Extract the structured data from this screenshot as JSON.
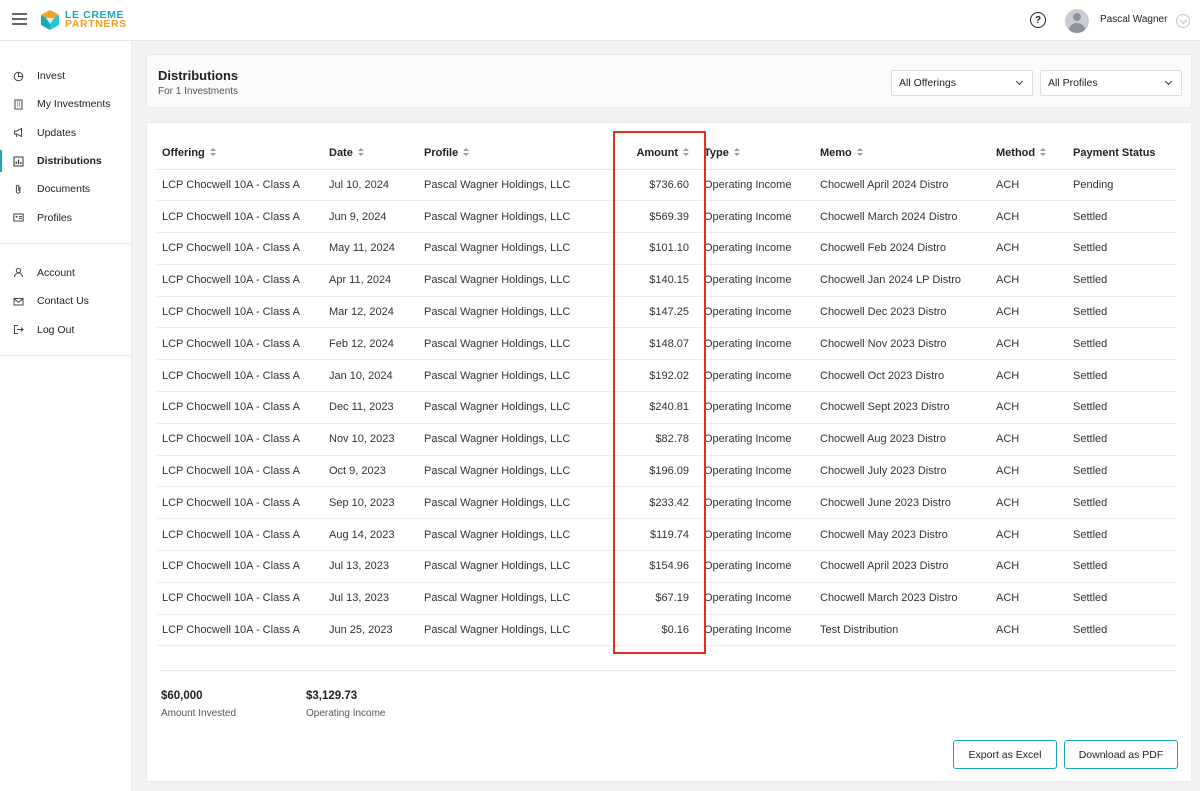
{
  "brand": {
    "line1": "LE CREME",
    "line2": "PARTNERS",
    "teal": "#1aa7b8",
    "orange": "#f0a325"
  },
  "topbar": {
    "help_glyph": "?",
    "username": "Pascal Wagner"
  },
  "sidebar": {
    "primary": [
      {
        "label": "Invest",
        "icon": "pie-chart-icon"
      },
      {
        "label": "My Investments",
        "icon": "building-icon"
      },
      {
        "label": "Updates",
        "icon": "megaphone-icon"
      },
      {
        "label": "Distributions",
        "icon": "report-icon",
        "active": true
      },
      {
        "label": "Documents",
        "icon": "paperclip-icon"
      },
      {
        "label": "Profiles",
        "icon": "id-card-icon"
      }
    ],
    "secondary": [
      {
        "label": "Account",
        "icon": "user-icon"
      },
      {
        "label": "Contact Us",
        "icon": "mail-icon"
      },
      {
        "label": "Log Out",
        "icon": "logout-icon"
      }
    ]
  },
  "header": {
    "title": "Distributions",
    "subtitle": "For 1 Investments",
    "filters": {
      "offerings": "All Offerings",
      "profiles": "All Profiles"
    }
  },
  "table": {
    "columns": [
      "Offering",
      "Date",
      "Profile",
      "Amount",
      "Type",
      "Memo",
      "Method",
      "Payment Status"
    ],
    "rows": [
      [
        "LCP Chocwell 10A - Class A",
        "Jul 10, 2024",
        "Pascal Wagner Holdings, LLC",
        "$736.60",
        "Operating Income",
        "Chocwell April 2024 Distro",
        "ACH",
        "Pending"
      ],
      [
        "LCP Chocwell 10A - Class A",
        "Jun 9, 2024",
        "Pascal Wagner Holdings, LLC",
        "$569.39",
        "Operating Income",
        "Chocwell March 2024 Distro",
        "ACH",
        "Settled"
      ],
      [
        "LCP Chocwell 10A - Class A",
        "May 11, 2024",
        "Pascal Wagner Holdings, LLC",
        "$101.10",
        "Operating Income",
        "Chocwell Feb 2024 Distro",
        "ACH",
        "Settled"
      ],
      [
        "LCP Chocwell 10A - Class A",
        "Apr 11, 2024",
        "Pascal Wagner Holdings, LLC",
        "$140.15",
        "Operating Income",
        "Chocwell Jan 2024 LP Distro",
        "ACH",
        "Settled"
      ],
      [
        "LCP Chocwell 10A - Class A",
        "Mar 12, 2024",
        "Pascal Wagner Holdings, LLC",
        "$147.25",
        "Operating Income",
        "Chocwell Dec 2023 Distro",
        "ACH",
        "Settled"
      ],
      [
        "LCP Chocwell 10A - Class A",
        "Feb 12, 2024",
        "Pascal Wagner Holdings, LLC",
        "$148.07",
        "Operating Income",
        "Chocwell Nov 2023 Distro",
        "ACH",
        "Settled"
      ],
      [
        "LCP Chocwell 10A - Class A",
        "Jan 10, 2024",
        "Pascal Wagner Holdings, LLC",
        "$192.02",
        "Operating Income",
        "Chocwell Oct 2023 Distro",
        "ACH",
        "Settled"
      ],
      [
        "LCP Chocwell 10A - Class A",
        "Dec 11, 2023",
        "Pascal Wagner Holdings, LLC",
        "$240.81",
        "Operating Income",
        "Chocwell Sept 2023 Distro",
        "ACH",
        "Settled"
      ],
      [
        "LCP Chocwell 10A - Class A",
        "Nov 10, 2023",
        "Pascal Wagner Holdings, LLC",
        "$82.78",
        "Operating Income",
        "Chocwell Aug 2023 Distro",
        "ACH",
        "Settled"
      ],
      [
        "LCP Chocwell 10A - Class A",
        "Oct 9, 2023",
        "Pascal Wagner Holdings, LLC",
        "$196.09",
        "Operating Income",
        "Chocwell July 2023 Distro",
        "ACH",
        "Settled"
      ],
      [
        "LCP Chocwell 10A - Class A",
        "Sep 10, 2023",
        "Pascal Wagner Holdings, LLC",
        "$233.42",
        "Operating Income",
        "Chocwell June 2023 Distro",
        "ACH",
        "Settled"
      ],
      [
        "LCP Chocwell 10A - Class A",
        "Aug 14, 2023",
        "Pascal Wagner Holdings, LLC",
        "$119.74",
        "Operating Income",
        "Chocwell May 2023 Distro",
        "ACH",
        "Settled"
      ],
      [
        "LCP Chocwell 10A - Class A",
        "Jul 13, 2023",
        "Pascal Wagner Holdings, LLC",
        "$154.96",
        "Operating Income",
        "Chocwell April 2023 Distro",
        "ACH",
        "Settled"
      ],
      [
        "LCP Chocwell 10A - Class A",
        "Jul 13, 2023",
        "Pascal Wagner Holdings, LLC",
        "$67.19",
        "Operating Income",
        "Chocwell March 2023 Distro",
        "ACH",
        "Settled"
      ],
      [
        "LCP Chocwell 10A - Class A",
        "Jun 25, 2023",
        "Pascal Wagner Holdings, LLC",
        "$0.16",
        "Operating Income",
        "Test Distribution",
        "ACH",
        "Settled"
      ]
    ],
    "highlight_color": "#e0301e"
  },
  "summary": {
    "amount_invested": {
      "value": "$60,000",
      "label": "Amount Invested"
    },
    "operating_income": {
      "value": "$3,129.73",
      "label": "Operating Income"
    }
  },
  "actions": {
    "export_excel": "Export as Excel",
    "download_pdf": "Download as PDF"
  }
}
